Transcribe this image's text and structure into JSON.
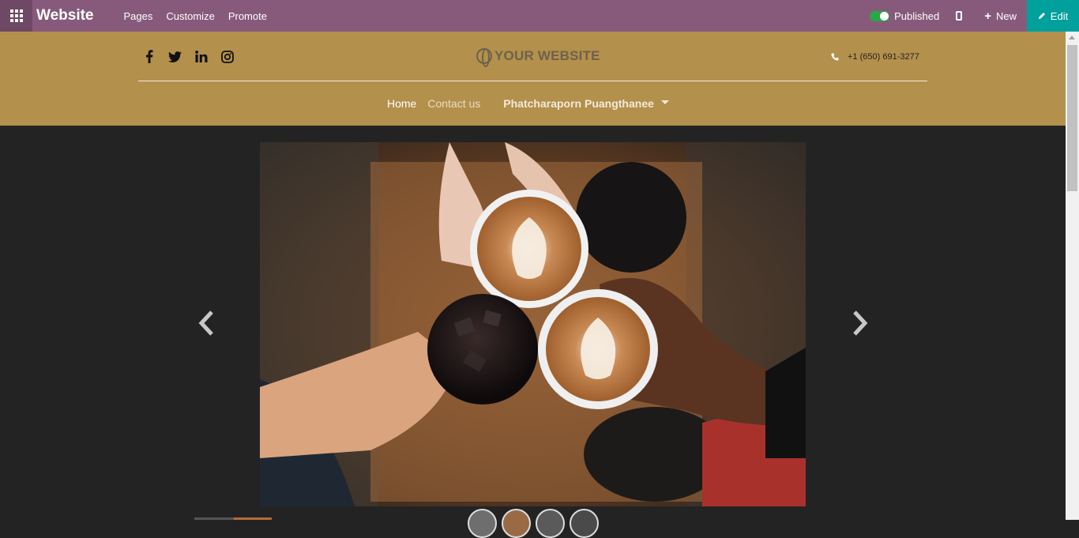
{
  "topbar": {
    "app_name": "Website",
    "menu": [
      "Pages",
      "Customize",
      "Promote"
    ],
    "published_label": "Published",
    "new_label": "New",
    "edit_label": "Edit",
    "colors": {
      "bar": "#875a7b",
      "apps": "#6e4865",
      "edit": "#00a09d",
      "toggle_on": "#28a745"
    }
  },
  "header": {
    "social_icons": [
      "facebook-icon",
      "twitter-icon",
      "linkedin-icon",
      "instagram-icon"
    ],
    "logo_text": "YOUR WEBSITE",
    "phone": "+1 (650) 691-3277",
    "nav": {
      "home": "Home",
      "contact": "Contact us",
      "user": "Phatcharaporn Puangthanee"
    },
    "colors": {
      "background": "#b4904d"
    }
  },
  "carousel": {
    "image_alt": "Coffee cups cheers",
    "prev_icon": "chevron-left-icon",
    "next_icon": "chevron-right-icon",
    "thumbnail_count": 4
  }
}
